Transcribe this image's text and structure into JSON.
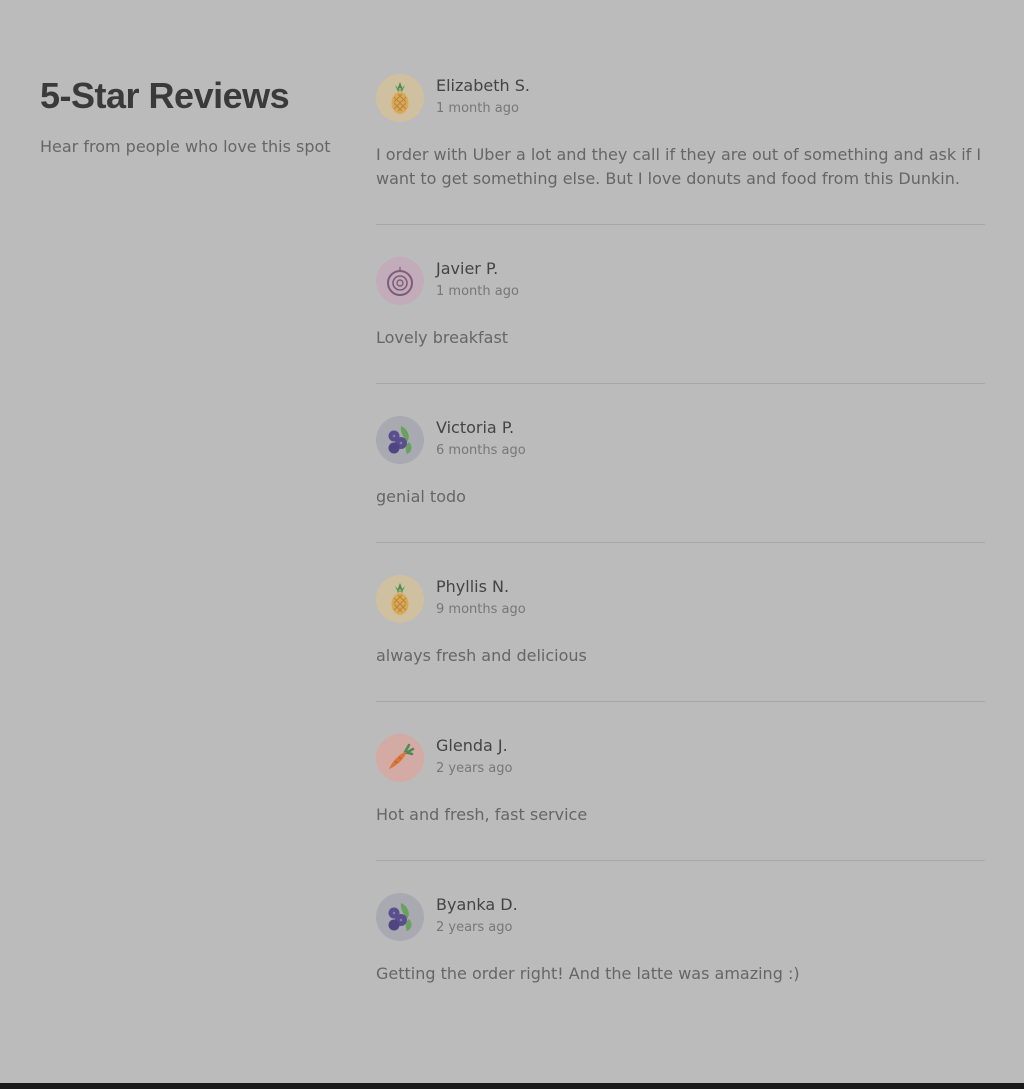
{
  "header": {
    "title": "5-Star Reviews",
    "subtitle": "Hear from people who love this spot"
  },
  "reviews": [
    {
      "name": "Elizabeth S.",
      "date": "1 month ago",
      "text": "I order with Uber a lot and they call if they are out of something and ask if I want to get something else. But I love donuts and food from this Dunkin.",
      "avatar_icon": "pineapple-icon",
      "avatar_bg": "#cfc09f"
    },
    {
      "name": "Javier P.",
      "date": "1 month ago",
      "text": "Lovely breakfast",
      "avatar_icon": "onion-icon",
      "avatar_bg": "#c3acba"
    },
    {
      "name": "Victoria P.",
      "date": "6 months ago",
      "text": "genial todo",
      "avatar_icon": "blueberry-icon",
      "avatar_bg": "#a9a9b2"
    },
    {
      "name": "Phyllis N.",
      "date": "9 months ago",
      "text": "always fresh and delicious",
      "avatar_icon": "pineapple-icon",
      "avatar_bg": "#cfc09f"
    },
    {
      "name": "Glenda J.",
      "date": "2 years ago",
      "text": "Hot and fresh, fast service",
      "avatar_icon": "carrot-icon",
      "avatar_bg": "#d3aaa4"
    },
    {
      "name": "Byanka D.",
      "date": "2 years ago",
      "text": "Getting the order right! And the latte was amazing :)",
      "avatar_icon": "blueberry-icon",
      "avatar_bg": "#a9a9b2"
    }
  ]
}
